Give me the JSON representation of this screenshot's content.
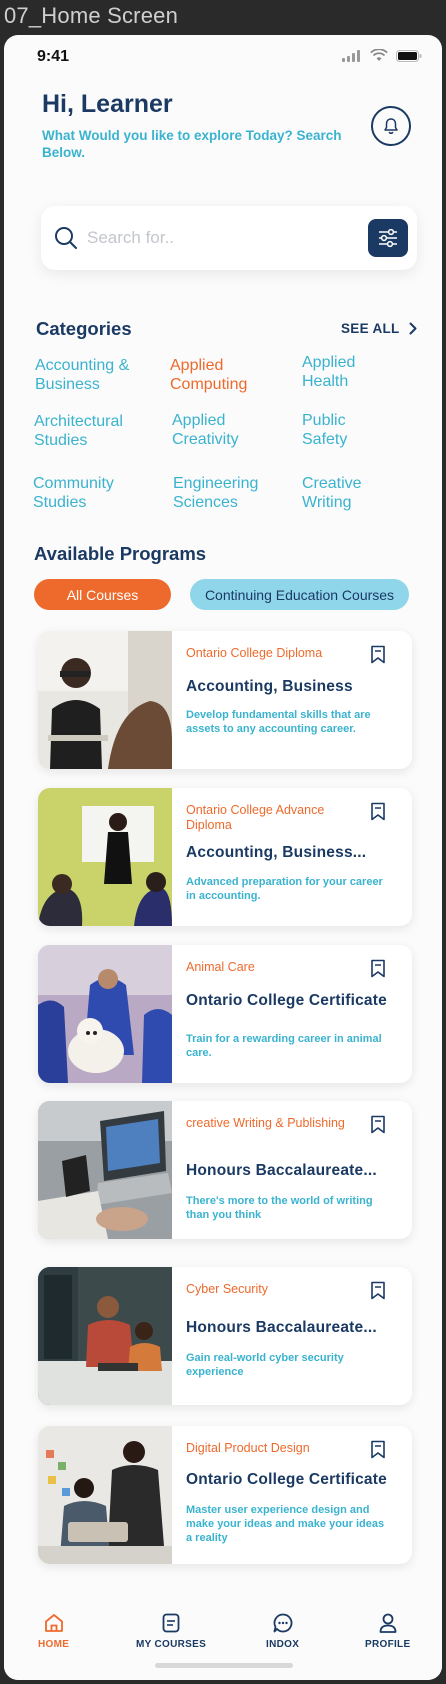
{
  "frame_title": "07_Home Screen",
  "status": {
    "time": "9:41"
  },
  "header": {
    "greeting": "Hi, Learner",
    "subtitle": "What Would you like to explore Today? Search Below."
  },
  "search": {
    "placeholder": "Search for.."
  },
  "categories": {
    "title": "Categories",
    "see_all": "SEE ALL",
    "items": [
      {
        "label": "Accounting & Business"
      },
      {
        "label": "Applied Computing",
        "active": true
      },
      {
        "label": "Applied Health"
      },
      {
        "label": "Architectural Studies"
      },
      {
        "label": "Applied Creativity"
      },
      {
        "label": "Public Safety"
      },
      {
        "label": "Community Studies"
      },
      {
        "label": "Engineering Sciences"
      },
      {
        "label": "Creative Writing"
      }
    ]
  },
  "programs": {
    "title": "Available Programs",
    "tabs": [
      {
        "label": "All Courses",
        "active": true
      },
      {
        "label": "Continuing Education Courses",
        "active": false
      }
    ],
    "cards": [
      {
        "category": "Ontario College Diploma",
        "title": "Accounting, Business",
        "description": "Develop fundamental skills that are assets to any accounting career."
      },
      {
        "category": "Ontario College Advance Diploma",
        "title": "Accounting, Business...",
        "description": "Advanced preparation for your career in accounting."
      },
      {
        "category": "Animal Care",
        "title": "Ontario College Certificate",
        "description": "Train for a rewarding career in animal care."
      },
      {
        "category": "creative Writing & Publishing",
        "title": "Honours Baccalaureate...",
        "description": "There's more to the world of writing than you think"
      },
      {
        "category": "Cyber Security",
        "title": "Honours Baccalaureate...",
        "description": "Gain real-world cyber security experience"
      },
      {
        "category": "Digital Product Design",
        "title": "Ontario College Certificate",
        "description": "Master user experience design and make your ideas and make your ideas a reality"
      }
    ]
  },
  "bottom_nav": {
    "items": [
      {
        "label": "HOME",
        "icon": "home-icon",
        "active": true
      },
      {
        "label": "MY COURSES",
        "icon": "courses-icon",
        "active": false
      },
      {
        "label": "INDOX",
        "icon": "chat-icon",
        "active": false
      },
      {
        "label": "PROFILE",
        "icon": "profile-icon",
        "active": false
      }
    ]
  },
  "colors": {
    "navy": "#1b3a63",
    "orange": "#ee6a2c",
    "teal": "#3ab3cf",
    "light_teal": "#8fd6ea"
  }
}
